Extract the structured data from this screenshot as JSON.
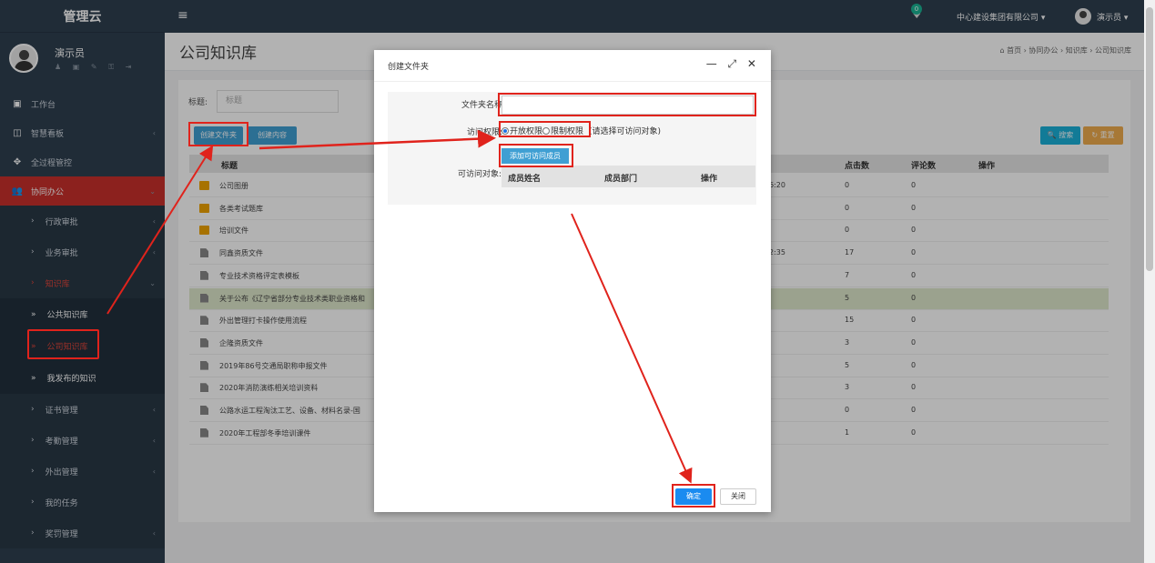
{
  "sidebar": {
    "brand": "管理云",
    "user_name": "演示员",
    "profile_icons": "♟ ▣ ✎ ⚿ ⇥",
    "items": [
      {
        "label": "工作台",
        "icon": "dashboard-icon",
        "glyph": "▣",
        "arrow": ""
      },
      {
        "label": "智慧看板",
        "icon": "board-icon",
        "glyph": "◫",
        "arrow": "‹"
      },
      {
        "label": "全过程管控",
        "icon": "control-icon",
        "glyph": "✥",
        "arrow": ""
      },
      {
        "label": "协同办公",
        "icon": "users-icon",
        "glyph": "👥",
        "arrow": "⌄"
      }
    ],
    "sub_items": [
      {
        "label": "行政审批",
        "chev": "›",
        "arrow": "‹"
      },
      {
        "label": "业务审批",
        "chev": "›",
        "arrow": "‹"
      },
      {
        "label": "知识库",
        "chev": "›",
        "arrow": "⌄"
      }
    ],
    "kb_items": [
      {
        "label": "公共知识库",
        "chev": "»"
      },
      {
        "label": "公司知识库",
        "chev": "»"
      },
      {
        "label": "我发布的知识",
        "chev": "»"
      }
    ],
    "more_items": [
      {
        "label": "证书管理",
        "chev": "›",
        "arrow": "‹"
      },
      {
        "label": "考勤管理",
        "chev": "›",
        "arrow": "‹"
      },
      {
        "label": "外出管理",
        "chev": "›",
        "arrow": "‹"
      },
      {
        "label": "我的任务",
        "chev": "›",
        "arrow": ""
      },
      {
        "label": "奖罚管理",
        "chev": "›",
        "arrow": "‹"
      }
    ]
  },
  "topbar": {
    "hamburger": "≡",
    "bell": "🔔",
    "bell_badge": "0",
    "company": "中心建设集团有限公司 ▾",
    "user": "演示员 ▾"
  },
  "header": {
    "title": "公司知识库",
    "breadcrumb": "⌂ 首页 › 协同办公 › 知识库 › 公司知识库"
  },
  "filter": {
    "label": "标题:",
    "placeholder": "标题"
  },
  "toolbar": {
    "new_folder": "创建文件夹",
    "new_content": "创建内容",
    "search": "🔍 搜索",
    "reset": "↻ 重置"
  },
  "table": {
    "columns": {
      "title": "标题",
      "clicks": "点击数",
      "comments": "评论数",
      "actions": "操作"
    },
    "rows": [
      {
        "type": "folder",
        "title": "公司图册",
        "date": "6:20",
        "clicks": "0",
        "comments": "0"
      },
      {
        "type": "folder",
        "title": "各类考试题库",
        "date": "",
        "clicks": "0",
        "comments": "0"
      },
      {
        "type": "folder",
        "title": "培训文件",
        "date": "",
        "clicks": "0",
        "comments": "0"
      },
      {
        "type": "file",
        "title": "同鑫资质文件",
        "date": "2:35",
        "clicks": "17",
        "comments": "0"
      },
      {
        "type": "file",
        "title": "专业技术资格评定表模板",
        "date": "",
        "clicks": "7",
        "comments": "0"
      },
      {
        "type": "file",
        "title": "关于公布《辽宁省部分专业技术类职业资格和",
        "date": "",
        "clicks": "5",
        "comments": "0"
      },
      {
        "type": "file",
        "title": "外出管理打卡操作使用流程",
        "date": "",
        "clicks": "15",
        "comments": "0"
      },
      {
        "type": "file",
        "title": "企隆资质文件",
        "date": "",
        "clicks": "3",
        "comments": "0"
      },
      {
        "type": "file",
        "title": "2019年86号交通局职称申报文件",
        "date": "",
        "clicks": "5",
        "comments": "0"
      },
      {
        "type": "file",
        "title": "2020年消防演练相关培训资料",
        "date": "",
        "clicks": "3",
        "comments": "0"
      },
      {
        "type": "file",
        "title": "公路水运工程淘汰工艺、设备、材料名录-国",
        "date": "",
        "clicks": "0",
        "comments": "0"
      },
      {
        "type": "file",
        "title": "2020年工程部冬季培训课件",
        "date": "",
        "clicks": "1",
        "comments": "0"
      }
    ]
  },
  "modal": {
    "title": "创建文件夹",
    "controls": "— ⤢ ✕",
    "folder_name_label": "文件夹名称:",
    "folder_name_value": "",
    "access_label": "访问权限:",
    "radio_open": "开放权限",
    "radio_restricted": "限制权限",
    "radio_hint": "(请选择可访问对象)",
    "add_member": "添加可访问成员",
    "visible_label": "可访问对象:",
    "member_columns": {
      "name": "成员姓名",
      "dept": "成员部门",
      "ops": "操作"
    },
    "ok": "确定",
    "close": "关闭"
  },
  "colors": {
    "sidebar": "#2f4050",
    "accent_red": "#c9302c",
    "annotation_red": "#e0231c",
    "primary_blue": "#3f9fd3",
    "search_cyan": "#1ab0d9",
    "reset_orange": "#f0ad4e"
  }
}
